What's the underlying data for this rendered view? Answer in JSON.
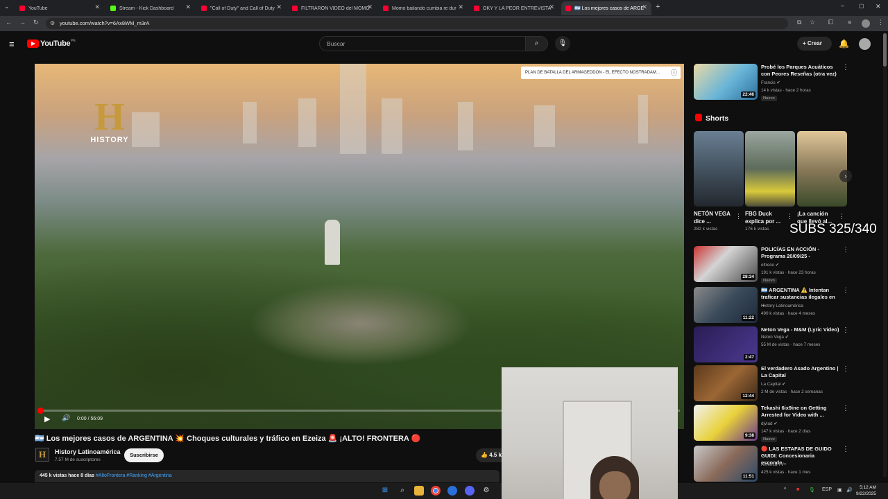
{
  "browser": {
    "tabs": [
      {
        "label": "YouTube",
        "favicon": "youtube"
      },
      {
        "label": "Stream - Kick Dashboard",
        "favicon": "kick"
      },
      {
        "label": "\"Call of Duty\" and Call of Duty",
        "favicon": "youtube"
      },
      {
        "label": "FILTRARON VIDEO del MOMO",
        "favicon": "youtube"
      },
      {
        "label": "Momo bailando cumbia re dur",
        "favicon": "youtube"
      },
      {
        "label": "OKY Y LA PEOR ENTREVISTA D",
        "favicon": "youtube"
      },
      {
        "label": "🇦🇷 Los mejores casos de ARGEN",
        "favicon": "youtube",
        "active": true
      }
    ],
    "url": "youtube.com/watch?v=6Ax8WM_m3rA"
  },
  "header": {
    "logo_text": "YouTube",
    "logo_region": "PE",
    "search_placeholder": "Buscar",
    "create_label": "Crear"
  },
  "video": {
    "watermark_letter": "H",
    "watermark_word": "HISTORY",
    "banner_text": "PLAN DE BATALLA DEL ARMAGEDDON - EL EFECTO NOSTRADAM...",
    "time_text": "0:00 / 56:09",
    "progress_fraction": 0.0
  },
  "info": {
    "title": "🇦🇷 Los mejores casos de ARGENTINA 💥 Choques culturales y tráfico en Ezeiza 🚨 ¡ALTO! FRONTERA 🔴",
    "channel_name": "History Latinoamérica",
    "channel_avatar_letter": "H",
    "subscribers": "7.57 M de suscriptores",
    "subscribe_label": "Suscribirse",
    "likes": "4.5 k",
    "views_date": "445 k vistas  hace 8 días",
    "tags": "#AltoFrontera #Ranking #Argentina"
  },
  "sidebar": {
    "top": {
      "title": "Probé los Parques Acuáticos con Peores Reseñas (otra vez)",
      "channel": "Francis ✔",
      "meta": "14 k vistas · hace 2 horas",
      "badge": "Nuevo",
      "duration": "22:46"
    },
    "shorts_label": "Shorts",
    "shorts": [
      {
        "title": "NETÓN VEGA dice ...",
        "views": "282 k vistas"
      },
      {
        "title": "FBG Duck explica por ...",
        "views": "176 k vistas"
      },
      {
        "title": "¡La canción que llevó al...",
        "views": ""
      }
    ],
    "videos": [
      {
        "title": "POLICÍAS EN ACCIÓN - Programa 20/09/25 -",
        "channel": "eltrece ✔",
        "meta": "191 k vistas · hace 23 horas",
        "badge": "Nuevo",
        "duration": "28:34"
      },
      {
        "title": "🇦🇷 ARGENTINA ⚠️ Intentan traficar sustancias ilegales en ...",
        "channel": "History Latinoamérica",
        "meta": "490 k vistas · hace 4 meses",
        "badge": "",
        "duration": "11:22"
      },
      {
        "title": "Neton Vega - M&M (Lyric Video)",
        "channel": "Neton Vega ✔",
        "meta": "55 M de vistas · hace 7 meses",
        "badge": "",
        "duration": "2:47"
      },
      {
        "title": "El verdadero Asado Argentino | La Capital",
        "channel": "La Capital ✔",
        "meta": "2 M de vistas · hace 2 semanas",
        "badge": "",
        "duration": "12:44"
      },
      {
        "title": "Tekashi 6ix9ine on Getting Arrested for Video with ...",
        "channel": "djvlad ✔",
        "meta": "147 k vistas · hace 2 días",
        "badge": "Nuevo",
        "duration": "9:38"
      },
      {
        "title": "🔴 LAS ESTAFAS DE GUIDO GUIDI: Concesionaria esconde...",
        "channel": "América TV",
        "meta": "425 k vistas · hace 1 mes",
        "badge": "",
        "duration": "11:51"
      }
    ]
  },
  "overlay": {
    "subs_counter": "SUBS 325/340"
  },
  "taskbar": {
    "lang": "ESP",
    "time": "5:12 AM",
    "date": "9/22/2025"
  },
  "colors": {
    "accent_red": "#ff0000",
    "link_blue": "#3ea6ff",
    "bg": "#0f0f0f"
  }
}
